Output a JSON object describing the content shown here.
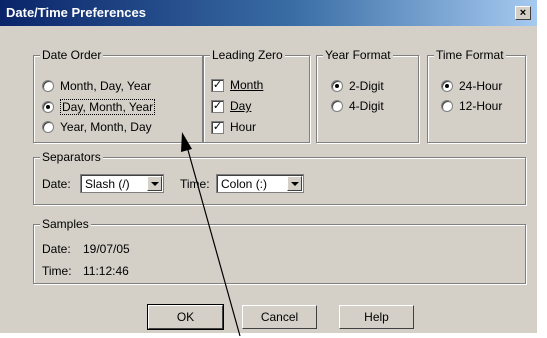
{
  "window": {
    "title": "Date/Time Preferences",
    "close_glyph": "×"
  },
  "date_order": {
    "legend": "Date Order",
    "options": [
      {
        "label": "Month, Day, Year",
        "selected": false
      },
      {
        "label": "Day, Month, Year",
        "selected": true
      },
      {
        "label": "Year, Month, Day",
        "selected": false
      }
    ]
  },
  "leading_zero": {
    "legend": "Leading Zero",
    "options": [
      {
        "label": "Month",
        "checked": true
      },
      {
        "label": "Day",
        "checked": true
      },
      {
        "label": "Hour",
        "checked": true
      }
    ]
  },
  "year_format": {
    "legend": "Year Format",
    "options": [
      {
        "label": "2-Digit",
        "selected": true
      },
      {
        "label": "4-Digit",
        "selected": false
      }
    ]
  },
  "time_format": {
    "legend": "Time Format",
    "options": [
      {
        "label": "24-Hour",
        "selected": true
      },
      {
        "label": "12-Hour",
        "selected": false
      }
    ]
  },
  "separators": {
    "legend": "Separators",
    "date_label": "Date:",
    "date_value": "Slash (/)",
    "time_label": "Time:",
    "time_value": "Colon (:)"
  },
  "samples": {
    "legend": "Samples",
    "date_label": "Date:",
    "date_value": "19/07/05",
    "time_label": "Time:",
    "time_value": "11:12:46"
  },
  "buttons": {
    "ok": "OK",
    "cancel": "Cancel",
    "help": "Help"
  },
  "colors": {
    "dialog_bg": "#d4d0c8",
    "title_start": "#0a246a",
    "title_end": "#a6caf0"
  }
}
